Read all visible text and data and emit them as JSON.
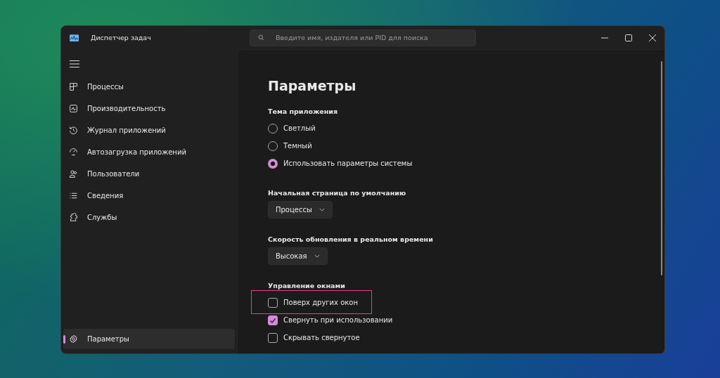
{
  "window": {
    "title": "Диспетчер задач"
  },
  "search": {
    "placeholder": "Введите имя, издателя или PID для поиска"
  },
  "sidebar": {
    "items": [
      {
        "label": "Процессы",
        "selected": false
      },
      {
        "label": "Производительность",
        "selected": false
      },
      {
        "label": "Журнал приложений",
        "selected": false
      },
      {
        "label": "Автозагрузка приложений",
        "selected": false
      },
      {
        "label": "Пользователи",
        "selected": false
      },
      {
        "label": "Сведения",
        "selected": false
      },
      {
        "label": "Службы",
        "selected": false
      }
    ],
    "footer": {
      "label": "Параметры",
      "selected": true
    }
  },
  "content": {
    "title": "Параметры",
    "sections": [
      {
        "kind": "radio",
        "heading": "Тема приложения",
        "options": [
          {
            "label": "Светлый",
            "selected": false
          },
          {
            "label": "Темный",
            "selected": false
          },
          {
            "label": "Использовать параметры системы",
            "selected": true
          }
        ]
      },
      {
        "kind": "dropdown",
        "heading": "Начальная страница по умолчанию",
        "value": "Процессы"
      },
      {
        "kind": "dropdown",
        "heading": "Скорость обновления в реальном времени",
        "value": "Высокая"
      },
      {
        "kind": "checkbox",
        "heading": "Управление окнами",
        "options": [
          {
            "label": "Поверх других окон",
            "checked": false,
            "highlighted": true
          },
          {
            "label": "Свернуть при использовании",
            "checked": true,
            "highlighted": false
          },
          {
            "label": "Скрывать свернутое",
            "checked": false,
            "highlighted": false
          }
        ]
      }
    ]
  }
}
